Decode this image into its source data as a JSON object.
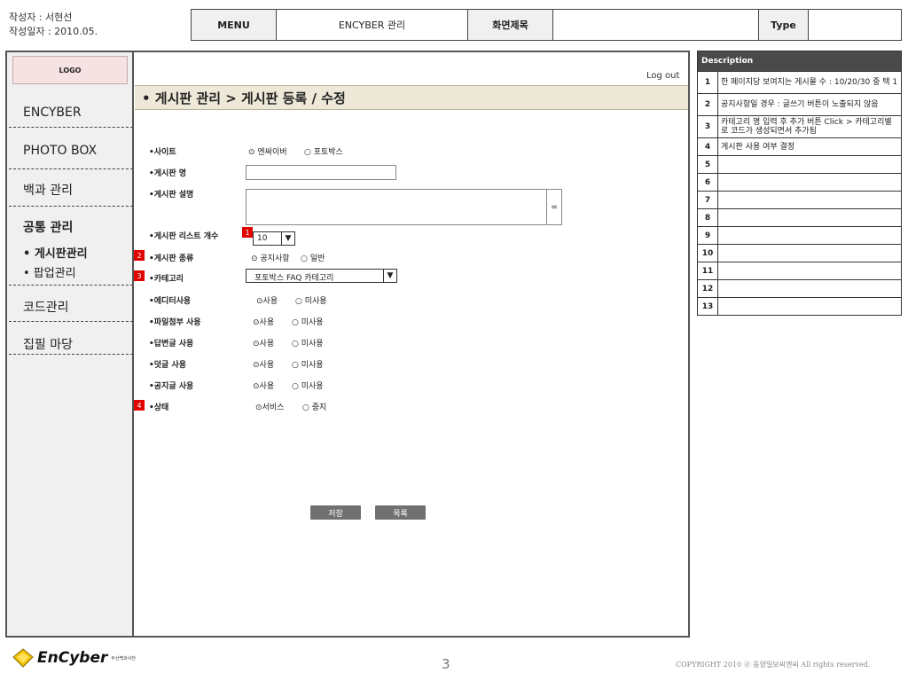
{
  "meta": {
    "author": "작성자 : 서현선",
    "date": "작성일자 : 2010.05."
  },
  "header": {
    "menu_label": "MENU",
    "menu_value": "ENCYBER 관리",
    "title_label": "화면제목",
    "title_value": "",
    "type_label": "Type",
    "type_value": ""
  },
  "sidebar": {
    "logo": "LOGO",
    "items": [
      {
        "label": "ENCYBER"
      },
      {
        "label": "PHOTO BOX"
      },
      {
        "label": "백과 관리"
      },
      {
        "label": "공통 관리"
      }
    ],
    "sub_items": [
      {
        "label": "• 게시판관리"
      },
      {
        "label": "• 팝업관리"
      }
    ],
    "more_items": [
      {
        "label": "코드관리"
      },
      {
        "label": "집필 마당"
      }
    ]
  },
  "main": {
    "logout": "Log out",
    "title": "• 게시판 관리 > 게시판 등록 / 수정",
    "fields": {
      "site_label": "•사이트",
      "site_opt1": "⊙ 엔싸이버",
      "site_opt2": "○ 포토박스",
      "name_label": "•게시판 명",
      "name_value": "",
      "desc_label": "•게시판 설명",
      "desc_value": "",
      "desc_scroll": "=",
      "list_count_label": "•게시판 리스트 개수",
      "list_count_value": "10",
      "type_label": "•게시판 종류",
      "type_opt1": "⊙ 공지사항",
      "type_opt2": "○ 일반",
      "category_label": "•카테고리",
      "category_value": "포토박스 FAQ 카테고리",
      "editor_label": "•에디터사용",
      "file_label": "•파일첨부 사용",
      "reply_label": "•답변글 사용",
      "comment_label": "•덧글 사용",
      "notice_label": "•공지글 사용",
      "use_on": "⊙사용",
      "use_off": "○ 미사용",
      "status_label": "•상태",
      "status_opt1": "⊙서비스",
      "status_opt2": "○ 중지"
    },
    "badges": [
      "1",
      "2",
      "3",
      "4"
    ],
    "save_button": "저장",
    "list_button": "목록",
    "dropdown_arrow": "▼"
  },
  "description": {
    "header": "Description",
    "rows": [
      {
        "num": "1",
        "text": "한 페이지당 보여지는 게시물 수 : 10/20/30 중 택 1"
      },
      {
        "num": "2",
        "text": "공지사항일 경우 : 글쓰기 버튼이 노출되지 않음"
      },
      {
        "num": "3",
        "text": "카테고리 명 입력 후 추가 버튼 Click > 카테고리별로 코드가 생성되면서 추가됨"
      },
      {
        "num": "4",
        "text": "게시판 사용 여부 결정"
      },
      {
        "num": "5",
        "text": ""
      },
      {
        "num": "6",
        "text": ""
      },
      {
        "num": "7",
        "text": ""
      },
      {
        "num": "8",
        "text": ""
      },
      {
        "num": "9",
        "text": ""
      },
      {
        "num": "10",
        "text": ""
      },
      {
        "num": "11",
        "text": ""
      },
      {
        "num": "12",
        "text": ""
      },
      {
        "num": "13",
        "text": ""
      }
    ]
  },
  "footer": {
    "brand": "EnCyber",
    "brand_sub": "두산백과사전",
    "page": "3",
    "copyright": "COPYRIGHT 2010 ⓓ 동양일보씨엔씨 All rights reserved."
  }
}
